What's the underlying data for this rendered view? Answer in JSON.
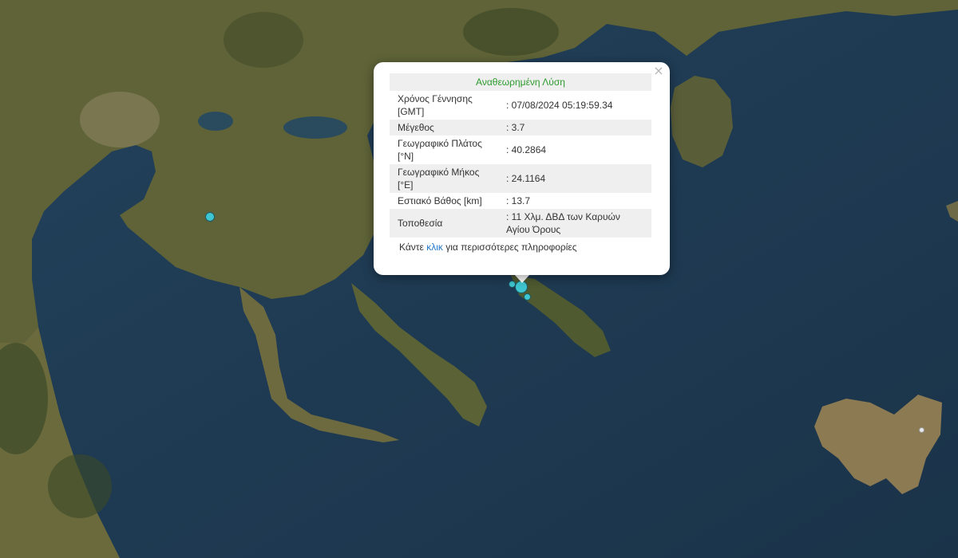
{
  "popup": {
    "title": "Αναθεωρημένη Λύση",
    "rows": [
      {
        "key": "Χρόνος Γέννησης [GMT]",
        "value": ": 07/08/2024 05:19:59.34"
      },
      {
        "key": "Μέγεθος",
        "value": ": 3.7"
      },
      {
        "key": "Γεωγραφικό Πλάτος [°N]",
        "value": ": 40.2864"
      },
      {
        "key": "Γεωγραφικό Μήκος [°E]",
        "value": ": 24.1164"
      },
      {
        "key": "Εστιακό Βάθος [km]",
        "value": ": 13.7"
      },
      {
        "key": "Τοποθεσία",
        "value": ": 11 Χλμ. ΔΒΔ των Καρυών Αγίου Όρους"
      }
    ],
    "more_prefix": "Κάντε",
    "more_link": "κλικ",
    "more_suffix": "για περισσότερες πληροφορίες",
    "close_symbol": "×"
  },
  "colors": {
    "sea": "#1f3a52",
    "land": "#6b6a3c",
    "marker": "#3fc6d0",
    "title": "#2e9a2e",
    "link": "#2277cc"
  },
  "icons": {
    "close": "close-icon",
    "marker": "earthquake-marker"
  }
}
